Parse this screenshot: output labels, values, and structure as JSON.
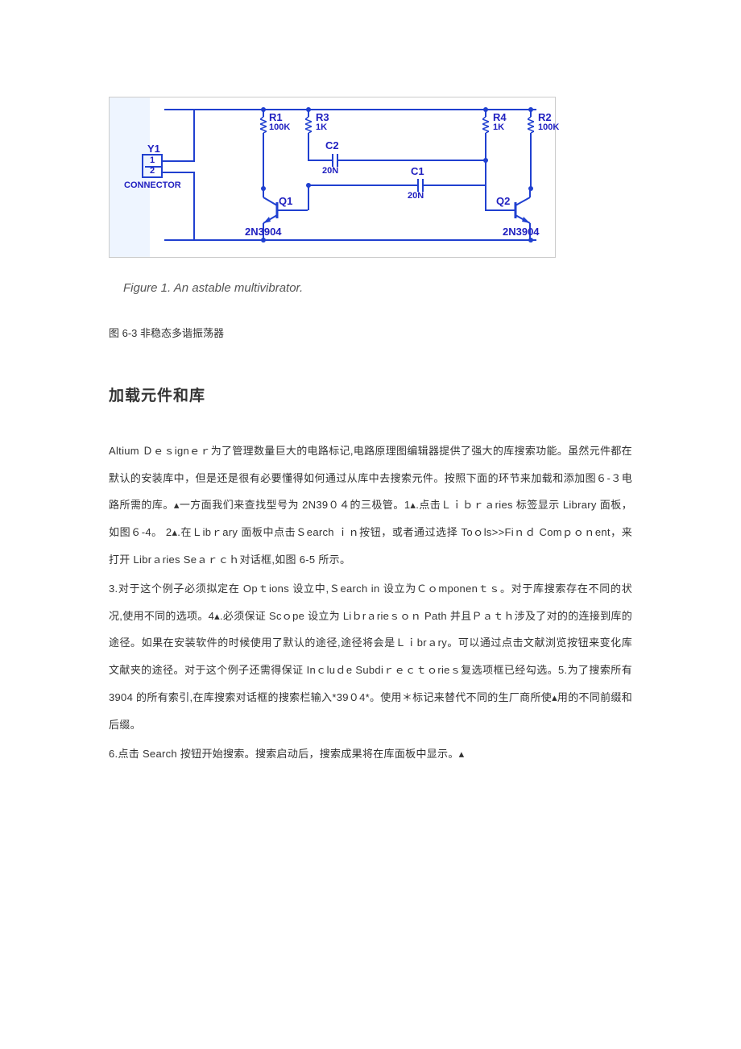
{
  "schematic": {
    "connector_name": "Y1",
    "connector_pin1": "1",
    "connector_pin2": "2",
    "connector_label": "CONNECTOR",
    "r1_name": "R1",
    "r1_value": "100K",
    "r3_name": "R3",
    "r3_value": "1K",
    "r4_name": "R4",
    "r4_value": "1K",
    "r2_name": "R2",
    "r2_value": "100K",
    "c2_name": "C2",
    "c2_value": "20N",
    "c1_name": "C1",
    "c1_value": "20N",
    "q1_name": "Q1",
    "q1_value": "2N3904",
    "q2_name": "Q2",
    "q2_value": "2N3904"
  },
  "figure": {
    "caption_en": "Figure 1. An astable multivibrator.",
    "caption_cn": "图 6-3  非稳态多谐振荡器"
  },
  "heading": "加载元件和库",
  "paragraphs": {
    "p1": "Altium  Ｄｅｓignｅｒ为了管理数量巨大的电路标记,电路原理图编辑器提供了强大的库搜索功能。虽然元件都在默认的安装库中，但是还是很有必要懂得如何通过从库中去搜索元件。按照下面的环节来加载和添加图６-３电路所需的库。▴一方面我们来查找型号为 2N39０４的三极管。1▴.点击Ｌｉｂｒａries 标签显示 Library 面板，如图６-4。   2▴.在Ｌibｒary 面板中点击Ｓearch  ｉｎ按钮，或者通过选择 Toｏls>>Fiｎｄ Comｐｏｎent，来打开 Librａries Seａｒｃｈ对话框,如图 6-5 所示。",
    "p2": "3.对于这个例子必须拟定在 Opｔions 设立中,Ｓearch   in   设立为Ｃｏmponenｔｓ。对于库搜索存在不同的状况,使用不同的选项。4▴.必须保证 Scｏpe 设立为 Liｂrａrieｓｏｎ  Path  并且Ｐａｔｈ涉及了对的的连接到库的途径。如果在安装软件的时候使用了默认的途径,途径将会是Ｌｉbrａry。可以通过点击文献浏览按钮来变化库文献夹的途径。对于这个例子还需得保证 Inｃluｄe Subdiｒｅｃｔｏrieｓ复选项框已经勾选。5.为了搜索所有 3904 的所有索引,在库搜索对话框的搜索栏输入*39０4*。使用＊标记来替代不同的生厂商所使▴用的不同前缀和后缀。",
    "p3": "6.点击 Search  按钮开始搜索。搜索启动后，搜索成果将在库面板中显示。▴"
  }
}
